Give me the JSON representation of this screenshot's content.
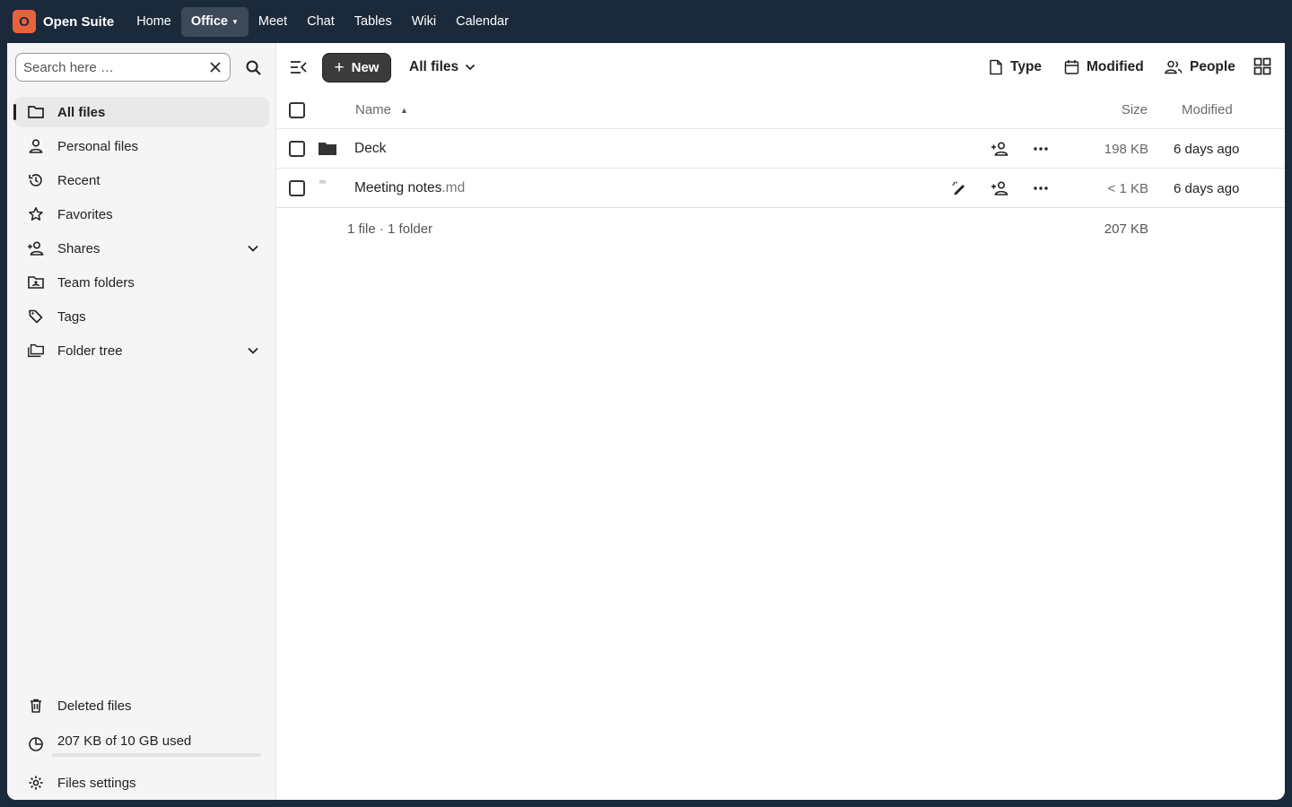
{
  "topbar": {
    "logo_letter": "O",
    "brand": "Open Suite",
    "nav": [
      {
        "label": "Home"
      },
      {
        "label": "Office"
      },
      {
        "label": "Meet"
      },
      {
        "label": "Chat"
      },
      {
        "label": "Tables"
      },
      {
        "label": "Wiki"
      },
      {
        "label": "Calendar"
      }
    ],
    "active_nav": "Office"
  },
  "sidebar": {
    "search": {
      "placeholder": "Search here …",
      "value": ""
    },
    "items": [
      {
        "label": "All files",
        "icon": "folder-icon",
        "active": true
      },
      {
        "label": "Personal files",
        "icon": "account-icon"
      },
      {
        "label": "Recent",
        "icon": "history-icon"
      },
      {
        "label": "Favorites",
        "icon": "star-icon"
      },
      {
        "label": "Shares",
        "icon": "account-plus-icon",
        "expandable": true
      },
      {
        "label": "Team folders",
        "icon": "team-folder-icon"
      },
      {
        "label": "Tags",
        "icon": "tag-icon"
      },
      {
        "label": "Folder tree",
        "icon": "folder-multiple-icon",
        "expandable": true
      }
    ],
    "deleted_files": "Deleted files",
    "quota": {
      "label": "207 KB of 10 GB used",
      "fraction": 0.0001
    },
    "settings": "Files settings"
  },
  "toolbar": {
    "new_label": "New",
    "breadcrumb": "All files",
    "filters": [
      {
        "label": "Type",
        "icon": "file-icon"
      },
      {
        "label": "Modified",
        "icon": "calendar-icon"
      },
      {
        "label": "People",
        "icon": "people-icon"
      }
    ]
  },
  "table": {
    "headers": {
      "name": "Name",
      "size": "Size",
      "modified": "Modified"
    },
    "rows": [
      {
        "name": "Deck",
        "ext": "",
        "type": "folder",
        "size": "198 KB",
        "modified": "6 days ago"
      },
      {
        "name": "Meeting notes",
        "ext": ".md",
        "type": "file",
        "size": "< 1 KB",
        "modified": "6 days ago"
      }
    ],
    "summary": {
      "text": "1 file · 1 folder",
      "size": "207 KB"
    }
  },
  "colors": {
    "topbar": "#1b2a3b",
    "logo": "#e9623c",
    "new_button": "#3b3b3b"
  }
}
